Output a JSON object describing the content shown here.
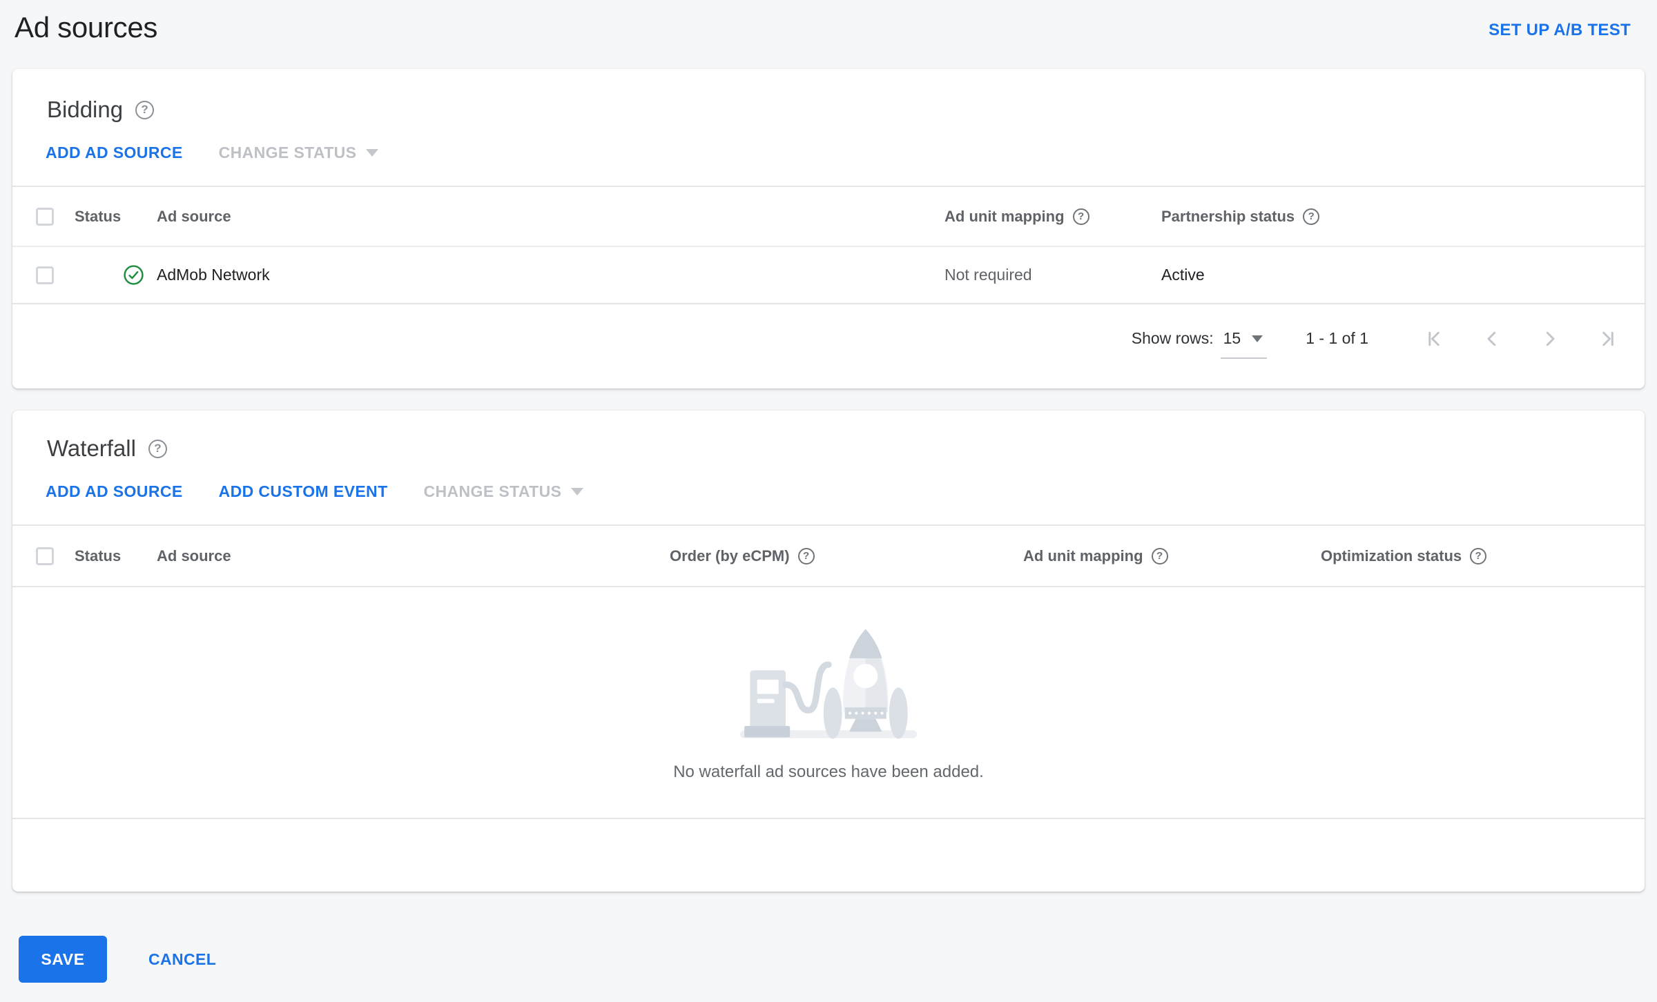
{
  "page": {
    "title": "Ad sources",
    "setup_ab_test": "SET UP A/B TEST"
  },
  "colors": {
    "accent_blue": "#1a73e8",
    "success_green": "#1e8e3e",
    "disabled_gray": "#bdc1c6",
    "page_background": "#f6f7f9"
  },
  "bidding": {
    "title": "Bidding",
    "actions": {
      "add_ad_source": "ADD AD SOURCE",
      "change_status": "CHANGE STATUS"
    },
    "columns": [
      "Status",
      "Ad source",
      "Ad unit mapping",
      "Partnership status"
    ],
    "rows": [
      {
        "status_icon": "check-circle-green",
        "ad_source": "AdMob Network",
        "ad_unit_mapping": "Not required",
        "partnership_status": "Active"
      }
    ],
    "footer": {
      "show_rows_label": "Show rows:",
      "rows_per_page": "15",
      "range": "1 - 1 of 1"
    }
  },
  "waterfall": {
    "title": "Waterfall",
    "actions": {
      "add_ad_source": "ADD AD SOURCE",
      "add_custom_event": "ADD CUSTOM EVENT",
      "change_status": "CHANGE STATUS"
    },
    "columns": [
      "Status",
      "Ad source",
      "Order (by eCPM)",
      "Ad unit mapping",
      "Optimization status"
    ],
    "empty_message": "No waterfall ad sources have been added."
  },
  "footer_actions": {
    "save": "SAVE",
    "cancel": "CANCEL"
  }
}
